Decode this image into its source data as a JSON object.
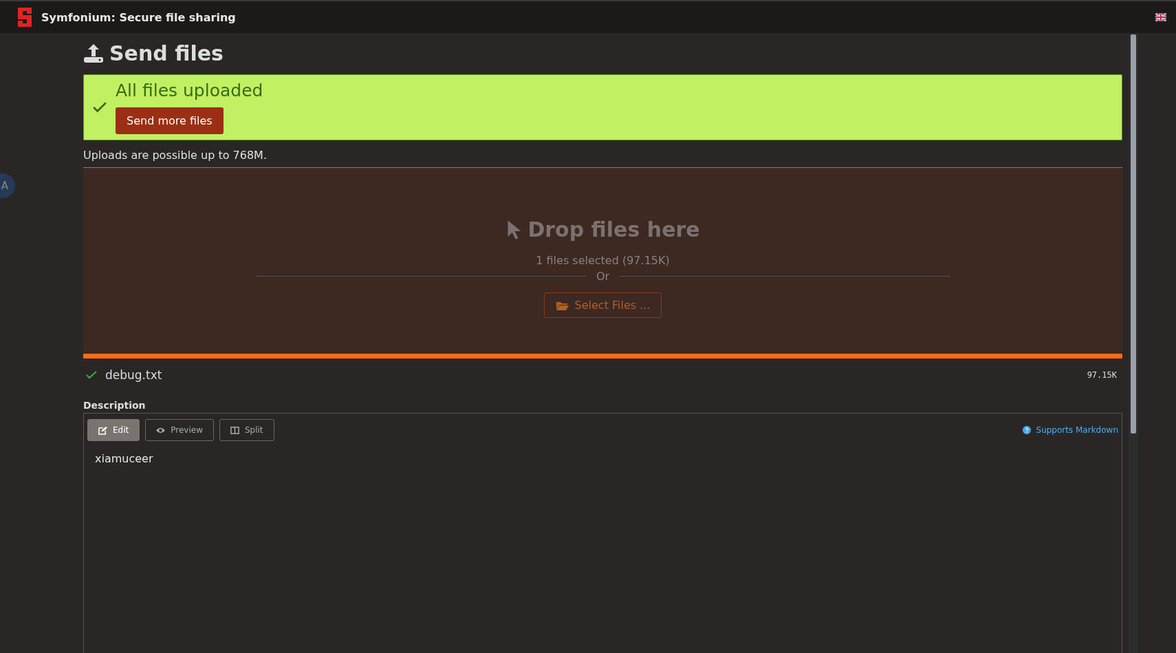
{
  "window": {
    "title": "Symfonium: Secure file sharing"
  },
  "floating_button": {
    "label": "A"
  },
  "page": {
    "title": "Send files"
  },
  "alert": {
    "kind": "success",
    "message": "All files uploaded",
    "button": "Send more files"
  },
  "upload_limit": "Uploads are possible up to 768M.",
  "dropzone": {
    "title": "Drop files here",
    "status": "1 files selected (97.15K)",
    "separator": "Or",
    "button": "Select Files ..."
  },
  "progress": {
    "level": 1
  },
  "files": [
    {
      "name": "debug.txt",
      "size": "97.15K",
      "uploaded": true
    }
  ],
  "description": {
    "label": "Description",
    "tabs": [
      {
        "label": "Edit",
        "kind": "edit",
        "selected": true
      },
      {
        "label": "Preview",
        "kind": "preview",
        "selected": false
      },
      {
        "label": "Split",
        "kind": "split",
        "selected": false
      }
    ],
    "help": "Supports Markdown",
    "value": "xiamuceer"
  }
}
